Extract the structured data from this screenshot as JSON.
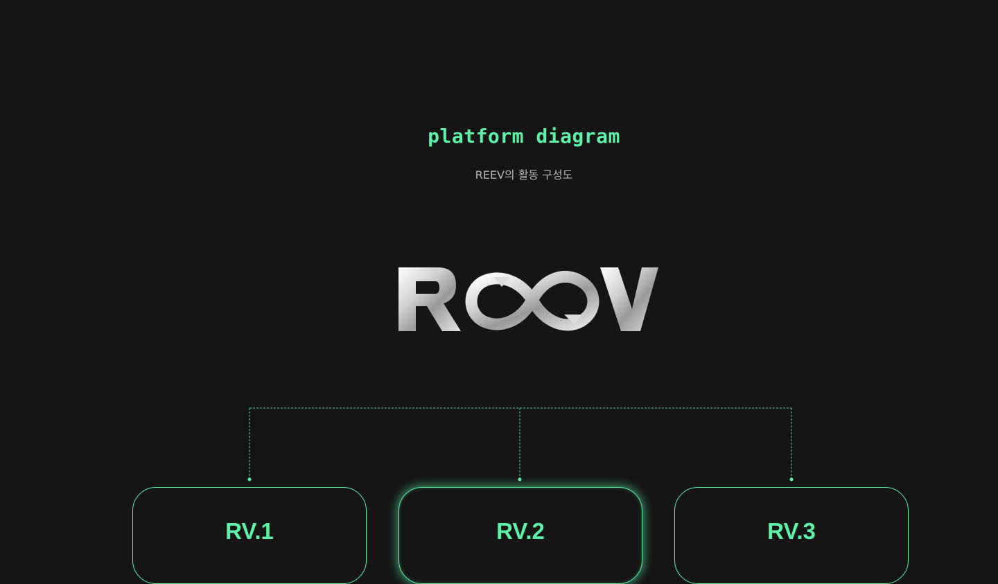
{
  "header": {
    "title": "platform diagram",
    "subtitle": "REEV의 활동 구성도"
  },
  "logo": {
    "text": "REEV",
    "icon": "infinity-logo-icon"
  },
  "nodes": [
    {
      "label": "RV.1",
      "active": false
    },
    {
      "label": "RV.2",
      "active": true
    },
    {
      "label": "RV.3",
      "active": false
    }
  ],
  "colors": {
    "background": "#151515",
    "accent": "#5cf2a8",
    "subtitle": "#b5b5b5",
    "logo": "#cfcfcf"
  }
}
